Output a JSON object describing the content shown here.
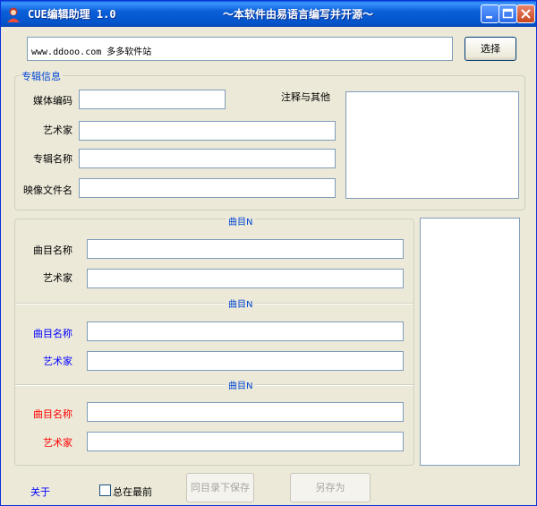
{
  "window": {
    "title": "CUE编辑助理 1.0",
    "subtitle": "～本软件由易语言编写并开源～"
  },
  "top": {
    "path_value": "www.ddooo.com 多多软件站",
    "browse_label": "选择"
  },
  "album": {
    "legend": "专辑信息",
    "fields": [
      {
        "label": "媒体编码",
        "value": ""
      },
      {
        "label": "艺术家",
        "value": ""
      },
      {
        "label": "专辑名称",
        "value": ""
      },
      {
        "label": "映像文件名",
        "value": ""
      }
    ],
    "notes_label": "注释与其他",
    "notes_value": ""
  },
  "tracks": [
    {
      "heading": "曲目N",
      "name_label": "曲目名称",
      "artist_label": "艺术家",
      "label_color": "#000000",
      "name_value": "",
      "artist_value": ""
    },
    {
      "heading": "曲目N",
      "name_label": "曲目名称",
      "artist_label": "艺术家",
      "label_color": "#0000ff",
      "name_value": "",
      "artist_value": ""
    },
    {
      "heading": "曲目N",
      "name_label": "曲目名称",
      "artist_label": "艺术家",
      "label_color": "#ff0000",
      "name_value": "",
      "artist_value": ""
    }
  ],
  "footer": {
    "about_label": "关于",
    "topmost_label": "总在最前",
    "topmost_checked": false,
    "save_same_dir_label": "同目录下保存",
    "save_as_label": "另存为"
  },
  "colors": {
    "titlebar": "#0a5fd8",
    "accent": "#0046d5",
    "window_bg": "#ece9d8"
  }
}
